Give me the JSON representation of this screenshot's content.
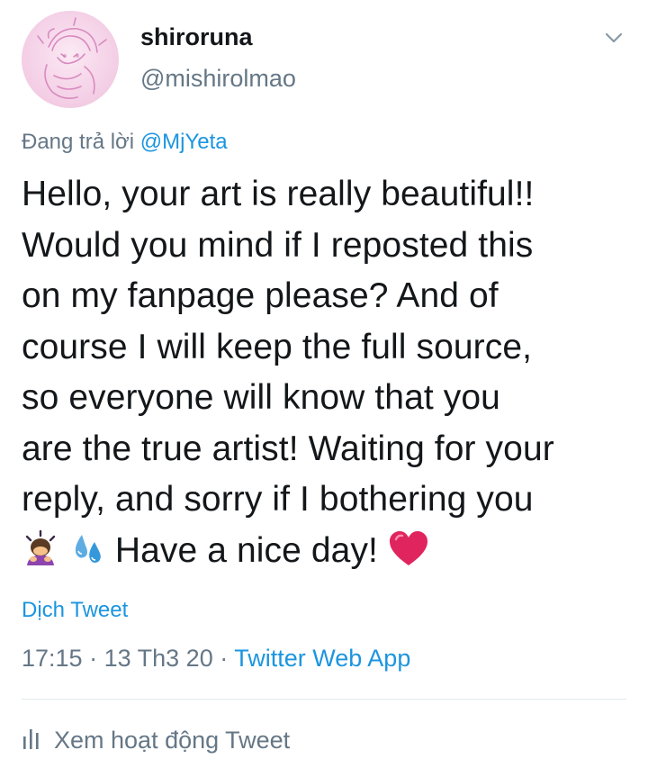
{
  "tweet": {
    "display_name": "shiroruna",
    "handle": "@mishirolmao",
    "reply_prefix": "Đang trả lời",
    "reply_to": "@MjYeta",
    "body_lines": [
      "Hello, your art is really beautiful!!",
      "Would you mind if I reposted this",
      "on my fanpage please? And of",
      "course I will keep the full source,",
      "so everyone will know that you",
      "are the true artist! Waiting for your",
      "reply, and sorry if I bothering you"
    ],
    "body_last_line": "Have a nice day!",
    "emojis": [
      "person-bowing-emoji",
      "sweat-droplets-emoji",
      "red-heart-emoji"
    ],
    "translate_label": "Dịch Tweet",
    "time": "17:15",
    "date": "13 Th3 20",
    "separator": "·",
    "source": "Twitter Web App",
    "activity_label": "Xem hoạt động Tweet"
  },
  "colors": {
    "link": "#1b95e0",
    "secondary": "#657786",
    "text": "#14171a",
    "divider": "#e1e8ed",
    "heart": "#e0245e"
  }
}
